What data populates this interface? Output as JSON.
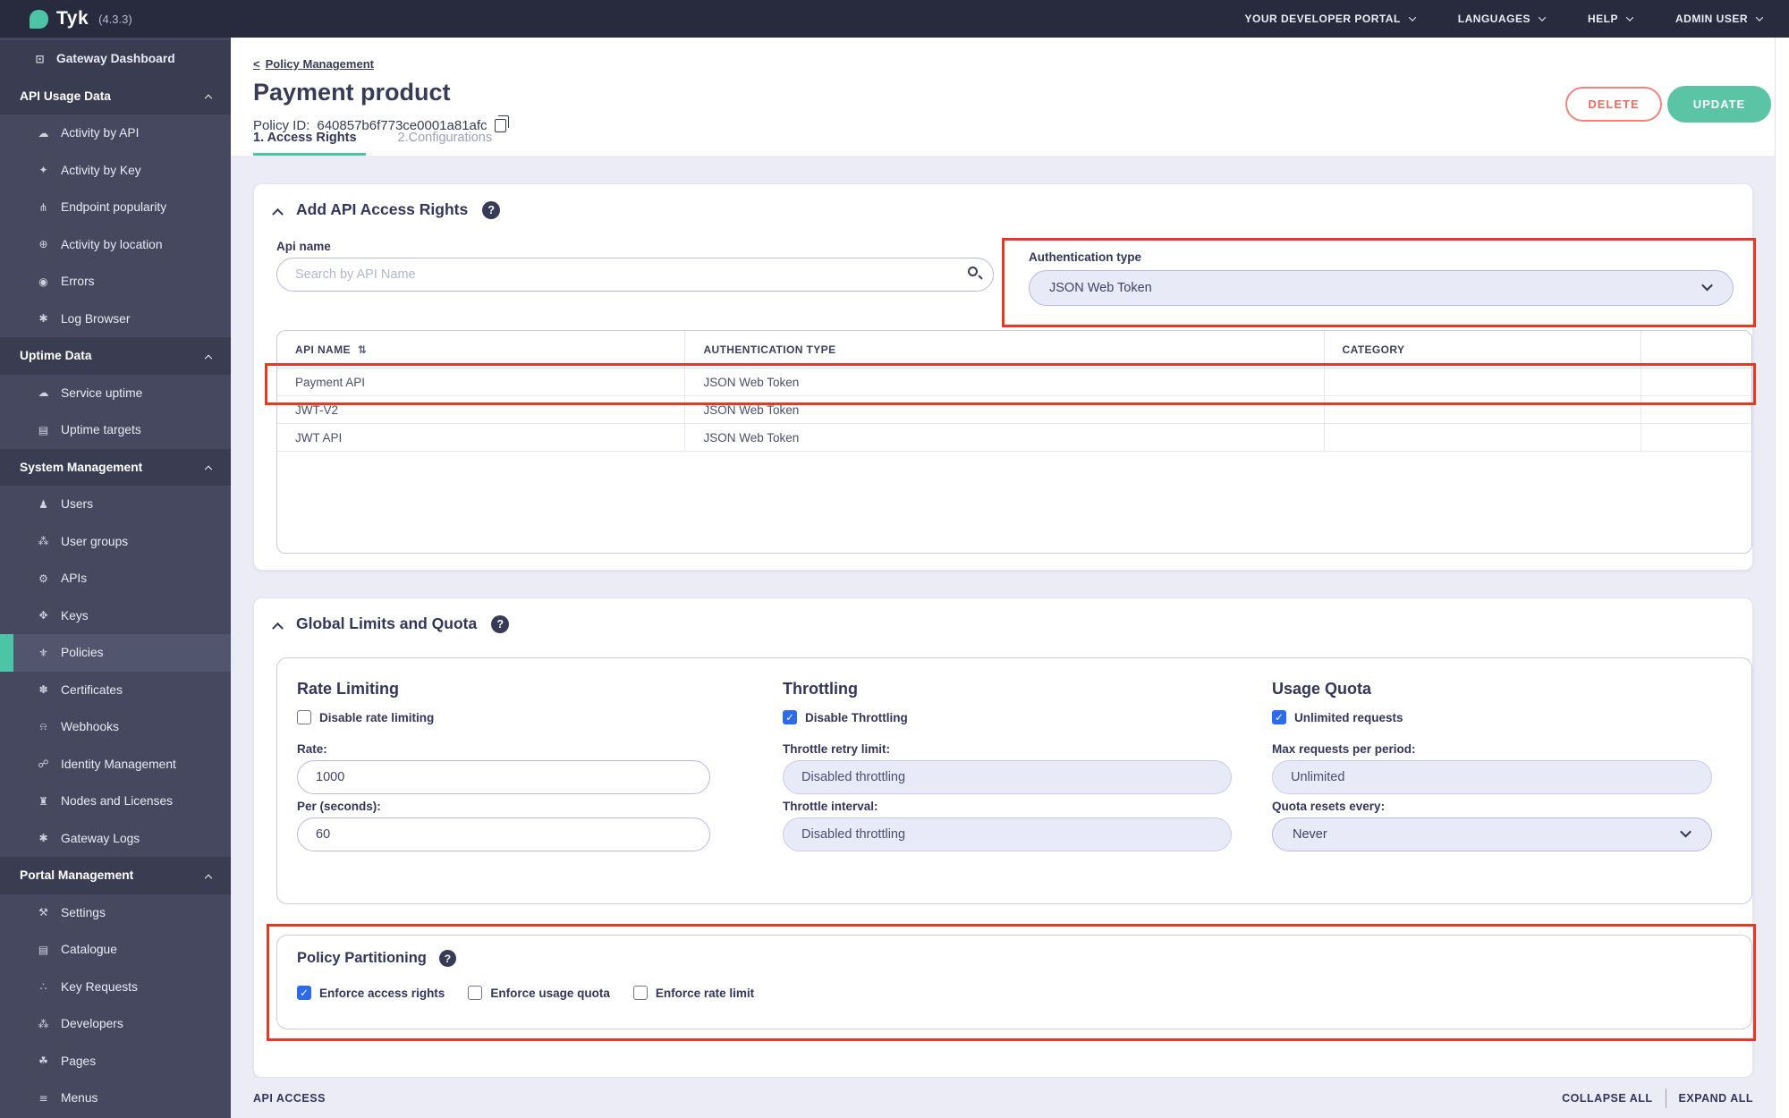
{
  "topbar": {
    "logo": "Tyk",
    "version": "(4.3.3)",
    "menu": [
      {
        "label": "YOUR DEVELOPER PORTAL"
      },
      {
        "label": "LANGUAGES"
      },
      {
        "label": "HELP"
      },
      {
        "label": "ADMIN USER"
      }
    ]
  },
  "sidebar": {
    "sections": [
      {
        "header": null,
        "items": [
          {
            "icon": "monitor",
            "label": "Gateway Dashboard"
          }
        ]
      },
      {
        "header": "API Usage Data",
        "items": [
          {
            "icon": "cloud",
            "label": "Activity by API"
          },
          {
            "icon": "key",
            "label": "Activity by Key"
          },
          {
            "icon": "fork",
            "label": "Endpoint popularity"
          },
          {
            "icon": "globe",
            "label": "Activity by location"
          },
          {
            "icon": "bomb",
            "label": "Errors"
          },
          {
            "icon": "bug",
            "label": "Log Browser"
          }
        ]
      },
      {
        "header": "Uptime Data",
        "items": [
          {
            "icon": "cloud",
            "label": "Service uptime"
          },
          {
            "icon": "list",
            "label": "Uptime targets"
          }
        ]
      },
      {
        "header": "System Management",
        "items": [
          {
            "icon": "user",
            "label": "Users"
          },
          {
            "icon": "users",
            "label": "User groups"
          },
          {
            "icon": "gears",
            "label": "APIs"
          },
          {
            "icon": "key-split",
            "label": "Keys"
          },
          {
            "icon": "policy",
            "label": "Policies",
            "active": true
          },
          {
            "icon": "rosette",
            "label": "Certificates"
          },
          {
            "icon": "bell",
            "label": "Webhooks"
          },
          {
            "icon": "hook",
            "label": "Identity Management"
          },
          {
            "icon": "bank",
            "label": "Nodes and Licenses"
          },
          {
            "icon": "bug",
            "label": "Gateway Logs"
          }
        ]
      },
      {
        "header": "Portal Management",
        "items": [
          {
            "icon": "wrench",
            "label": "Settings"
          },
          {
            "icon": "list",
            "label": "Catalogue"
          },
          {
            "icon": "paw",
            "label": "Key Requests"
          },
          {
            "icon": "users",
            "label": "Developers"
          },
          {
            "icon": "leaf",
            "label": "Pages"
          },
          {
            "icon": "menu",
            "label": "Menus"
          }
        ]
      }
    ]
  },
  "header": {
    "breadcrumb": "Policy Management",
    "title": "Payment product",
    "policy_id_label": "Policy ID:",
    "policy_id": "640857b6f773ce0001a81afc",
    "tabs": [
      {
        "label": "1. Access Rights",
        "active": true
      },
      {
        "label": "2.Configurations",
        "active": false
      }
    ],
    "delete_label": "DELETE",
    "update_label": "UPDATE"
  },
  "access_rights": {
    "title": "Add API Access Rights",
    "api_name_label": "Api name",
    "search_placeholder": "Search by API Name",
    "auth_type_label": "Authentication type",
    "auth_type_value": "JSON Web Token",
    "table": {
      "columns": [
        "API NAME",
        "AUTHENTICATION TYPE",
        "CATEGORY",
        ""
      ],
      "rows": [
        [
          "Payment API",
          "JSON Web Token",
          "",
          ""
        ],
        [
          "JWT-V2",
          "JSON Web Token",
          "",
          ""
        ],
        [
          "JWT API",
          "JSON Web Token",
          "",
          ""
        ]
      ]
    }
  },
  "limits": {
    "title": "Global Limits and Quota",
    "rate": {
      "title": "Rate Limiting",
      "checkbox": "Disable rate limiting",
      "checked": false,
      "rate_label": "Rate:",
      "rate_value": "1000",
      "per_label": "Per (seconds):",
      "per_value": "60"
    },
    "throttle": {
      "title": "Throttling",
      "checkbox": "Disable Throttling",
      "checked": true,
      "retry_label": "Throttle retry limit:",
      "retry_value": "Disabled throttling",
      "interval_label": "Throttle interval:",
      "interval_value": "Disabled throttling"
    },
    "quota": {
      "title": "Usage Quota",
      "checkbox": "Unlimited requests",
      "checked": true,
      "max_label": "Max requests per period:",
      "max_value": "Unlimited",
      "resets_label": "Quota resets every:",
      "resets_value": "Never"
    }
  },
  "partitioning": {
    "title": "Policy Partitioning",
    "options": [
      {
        "label": "Enforce access rights",
        "checked": true
      },
      {
        "label": "Enforce usage quota",
        "checked": false
      },
      {
        "label": "Enforce rate limit",
        "checked": false
      }
    ]
  },
  "footer": {
    "section": "API ACCESS",
    "collapse": "COLLAPSE ALL",
    "expand": "EXPAND ALL"
  },
  "colors": {
    "accent_teal": "#4cc5a6",
    "annotation_red": "#e8381f",
    "checkbox_blue": "#2e6bea",
    "sidebar_bg": "#45485f",
    "topbar_bg": "#272b3d"
  }
}
